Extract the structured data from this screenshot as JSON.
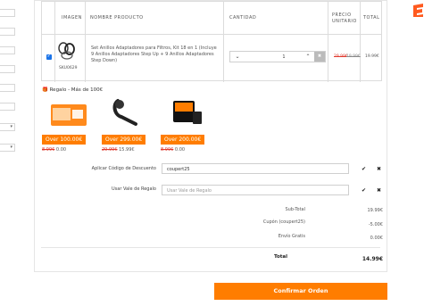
{
  "table": {
    "headers": {
      "image": "IMAGEN",
      "name": "NOMBRE PRODUCTO",
      "qty": "CANTIDAD",
      "unit_price": "PRECIO UNITARIO",
      "total": "TOTAL"
    },
    "rows": [
      {
        "sku": "SKU0629",
        "name": "Set Anillos Adaptadores para Filtros, Kit 18 en 1 (Incluye 9 Anillos Adaptadores Step Up + 9 Anillos Adaptadores Step Down)",
        "quantity": "1",
        "old_price": "29.99€",
        "price": "19.99€",
        "total": "19.99€"
      }
    ]
  },
  "gifts": {
    "title": "Regalo - Más de 100€",
    "items": [
      {
        "button": "Over 100.00€",
        "old_price": "8.99€",
        "price": "0.00"
      },
      {
        "button": "Over 299.00€",
        "old_price": "29.99€",
        "price": "15.99€"
      },
      {
        "button": "Over 200.00€",
        "old_price": "8.99€",
        "price": "0.00"
      }
    ]
  },
  "discount": {
    "coupon_label": "Aplicar Código de Descuento",
    "coupon_value": "coupert25",
    "voucher_label": "Usar Vale de Regalo",
    "voucher_placeholder": "Usar Vale de Regalo"
  },
  "summary": {
    "subtotal_label": "Sub-Total",
    "subtotal": "19.99€",
    "coupon_label": "Cupón (coupert25)",
    "coupon": "-5.00€",
    "shipping_label": "Envío Gratis",
    "shipping": "0.00€",
    "total_label": "Total",
    "total": "14.99€"
  },
  "actions": {
    "confirm": "Confirmar Orden"
  },
  "colors": {
    "accent": "#ff7d00",
    "strike": "#e03a2f",
    "checkbox": "#1a73e8"
  }
}
